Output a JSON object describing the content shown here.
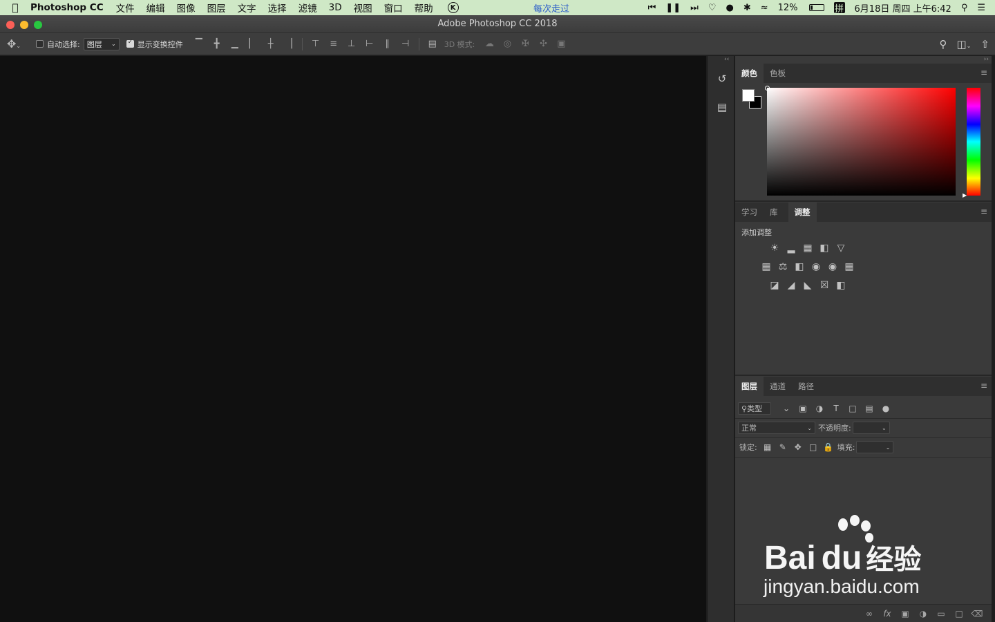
{
  "menubar": {
    "app_name": "Photoshop CC",
    "menus": [
      "文件",
      "编辑",
      "图像",
      "图层",
      "文字",
      "选择",
      "滤镜",
      "3D",
      "视图",
      "窗口",
      "帮助"
    ],
    "k_icon": "K",
    "now_playing": "每次走过",
    "battery_text": "12%",
    "ime_label": "拼",
    "clock": "6月18日 周四 上午6:42",
    "icons": [
      "apple-icon",
      "previous-track-icon",
      "pause-icon",
      "next-track-icon",
      "heart-icon",
      "qq-icon",
      "bluetooth-icon",
      "wifi-icon",
      "battery-icon",
      "spotlight-icon",
      "notification-list-icon"
    ]
  },
  "titlebar": {
    "title": "Adobe Photoshop CC 2018"
  },
  "options": {
    "auto_select_label": "自动选择:",
    "auto_select_checked": false,
    "auto_select_target": "图层",
    "show_transform_label": "显示变换控件",
    "show_transform_checked": true,
    "mode_3d_label": "3D 模式:"
  },
  "dock": {
    "buttons": [
      "history-icon",
      "properties-icon"
    ]
  },
  "color_panel": {
    "tabs": [
      "颜色",
      "色板"
    ],
    "active_tab": "颜色",
    "foreground": "#ffffff",
    "background": "#000000",
    "hue": "#ff0000"
  },
  "adjust_panel": {
    "tabs": [
      "学习",
      "库",
      "调整"
    ],
    "active_tab": "调整",
    "add_adjustment_label": "添加调整",
    "rows": [
      [
        "brightness-contrast-icon",
        "levels-icon",
        "curves-icon",
        "exposure-icon",
        "vibrance-icon"
      ],
      [
        "hue-saturation-icon",
        "color-balance-icon",
        "black-white-icon",
        "photo-filter-icon",
        "channel-mixer-icon",
        "color-lookup-icon"
      ],
      [
        "invert-icon",
        "posterize-icon",
        "threshold-icon",
        "selective-color-icon",
        "gradient-map-icon"
      ]
    ]
  },
  "layers_panel": {
    "tabs": [
      "图层",
      "通道",
      "路径"
    ],
    "active_tab": "图层",
    "filter_kind_placeholder": "类型",
    "blend_mode": "正常",
    "opacity_label": "不透明度:",
    "opacity_value": "",
    "lock_label": "锁定:",
    "fill_label": "填充:",
    "fill_value": "",
    "footer_icons": [
      "link-layers-icon",
      "fx-icon",
      "add-mask-icon",
      "adjustment-layer-icon",
      "new-group-icon",
      "new-layer-icon",
      "trash-icon"
    ]
  },
  "watermark": {
    "logo_text": "Bai",
    "logo_text_2": "du",
    "logo_text_cn": "经验",
    "url": "jingyan.baidu.com"
  }
}
